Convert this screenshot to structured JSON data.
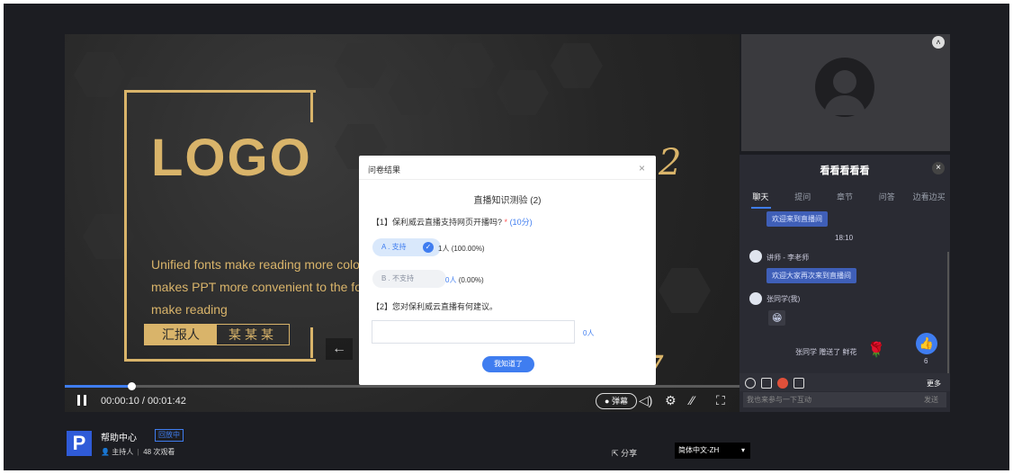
{
  "slide": {
    "logo": "LOGO",
    "line1": "Unified fonts make reading more colo",
    "line2": "makes PPT more convenient to the fo",
    "line3": "make reading",
    "reporter_label": "汇报人",
    "reporter_name": "某某某",
    "prev_arrow": "←"
  },
  "player": {
    "time": "00:00:10 / 00:01:42",
    "progress": 0.1,
    "danmu_label": "● 弹幕"
  },
  "camera": {
    "collapse_icon": "˄"
  },
  "chat": {
    "title": "看看看看看",
    "close": "×",
    "tabs": [
      "聊天",
      "提问",
      "章节",
      "问答",
      "边看边买"
    ],
    "messages": [
      {
        "text": "欢迎来到直播间"
      },
      {
        "time": "18:10"
      },
      {
        "author": "讲师 - 李老师",
        "text": "欢迎大家再次来到直播间"
      },
      {
        "author": "张同学(我)",
        "emoji": "😁"
      }
    ],
    "gift_text": "张同学 赠送了 鲜花",
    "gift_icon": "🌹",
    "like_count": "6",
    "more": "更多",
    "input_placeholder": "我也来参与一下互动",
    "send": "发送"
  },
  "modal": {
    "header": "问卷结果",
    "close": "×",
    "title": "直播知识测验 (2)",
    "q1": "【1】保利威云直播支持网页开播吗?",
    "q1_star": "*",
    "q1_points": "(10分)",
    "opt_a": "A . 支持",
    "opt_a_count": "1人",
    "opt_a_pct": "(100.00%)",
    "opt_b": "B . 不支持",
    "opt_b_count": "0人",
    "opt_b_pct": "(0.00%)",
    "q2": "【2】您对保利威云直播有何建议。",
    "q2_count": "0人",
    "ok": "我知道了"
  },
  "footer": {
    "logo": "P",
    "name": "帮助中心",
    "badge": "回放中",
    "host": "主持人",
    "views": "48 次观看",
    "share": "分享",
    "lang": "简体中文-ZH"
  },
  "colors": {
    "accent": "#3f7df0",
    "gold": "#d9b46a",
    "bg": "#1c1d22"
  }
}
